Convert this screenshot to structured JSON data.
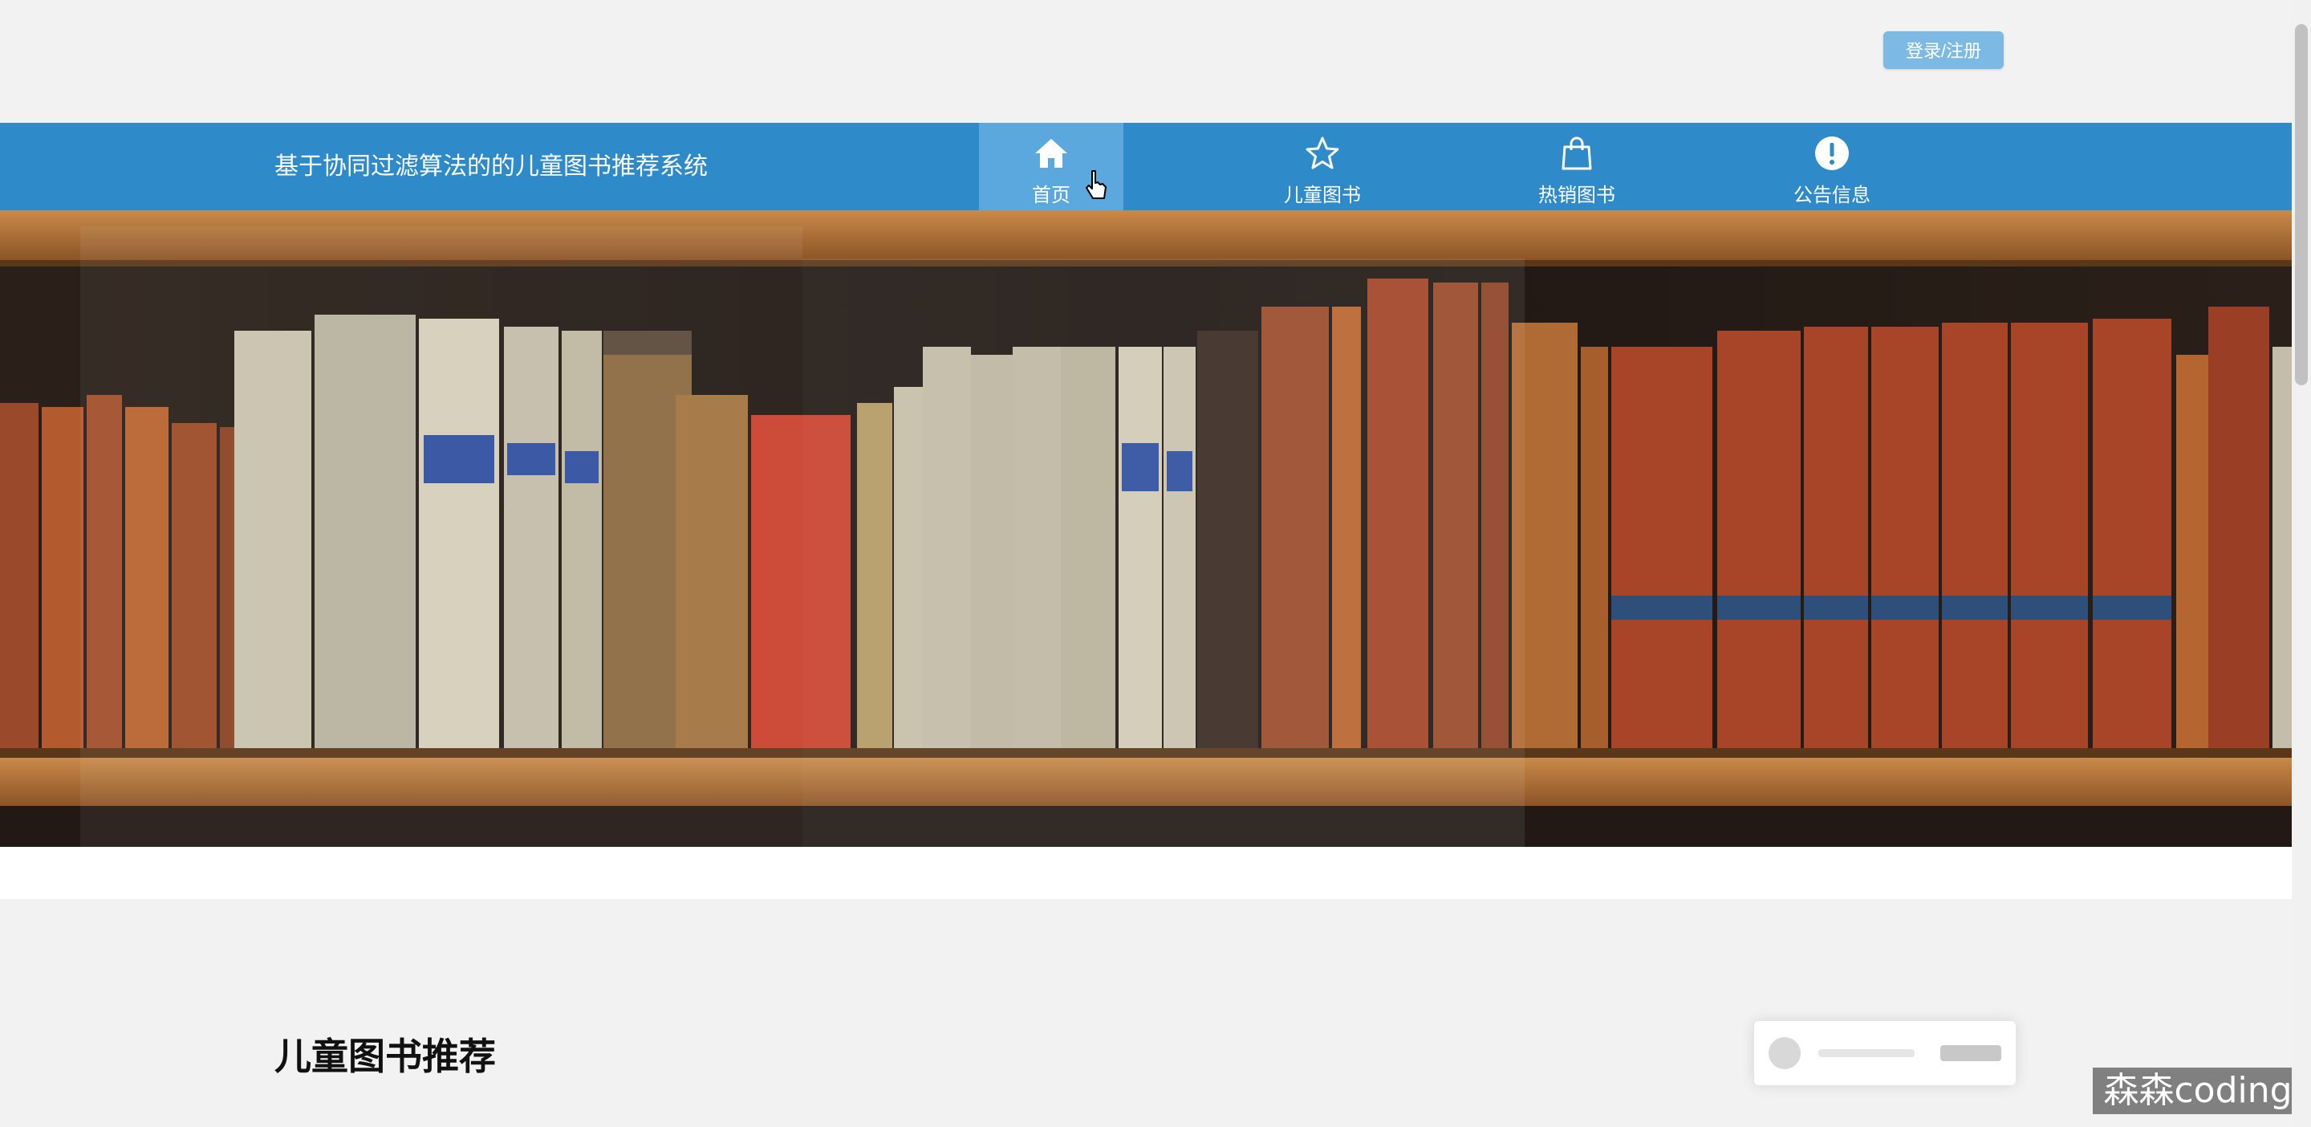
{
  "header": {
    "login_label": "登录/注册"
  },
  "nav": {
    "site_title": "基于协同过滤算法的的儿童图书推荐系统",
    "items": [
      {
        "label": "首页",
        "icon": "home-icon"
      },
      {
        "label": "儿童图书",
        "icon": "star-icon"
      },
      {
        "label": "热销图书",
        "icon": "shopping-bag-icon"
      },
      {
        "label": "公告信息",
        "icon": "exclamation-icon"
      }
    ],
    "active_index": 0
  },
  "banner": {
    "image": "bookshelf-photo",
    "slide_count": 3,
    "active_slide": 3
  },
  "sections": {
    "recommend_title": "儿童图书推荐"
  },
  "watermark": "森森coding",
  "colors": {
    "nav_bg": "#2f8ac9",
    "nav_active": "#5aa8dd",
    "login_btn": "#7cb9e3",
    "dot_active": "#3e92cf",
    "page_bg": "#f2f2f2"
  }
}
